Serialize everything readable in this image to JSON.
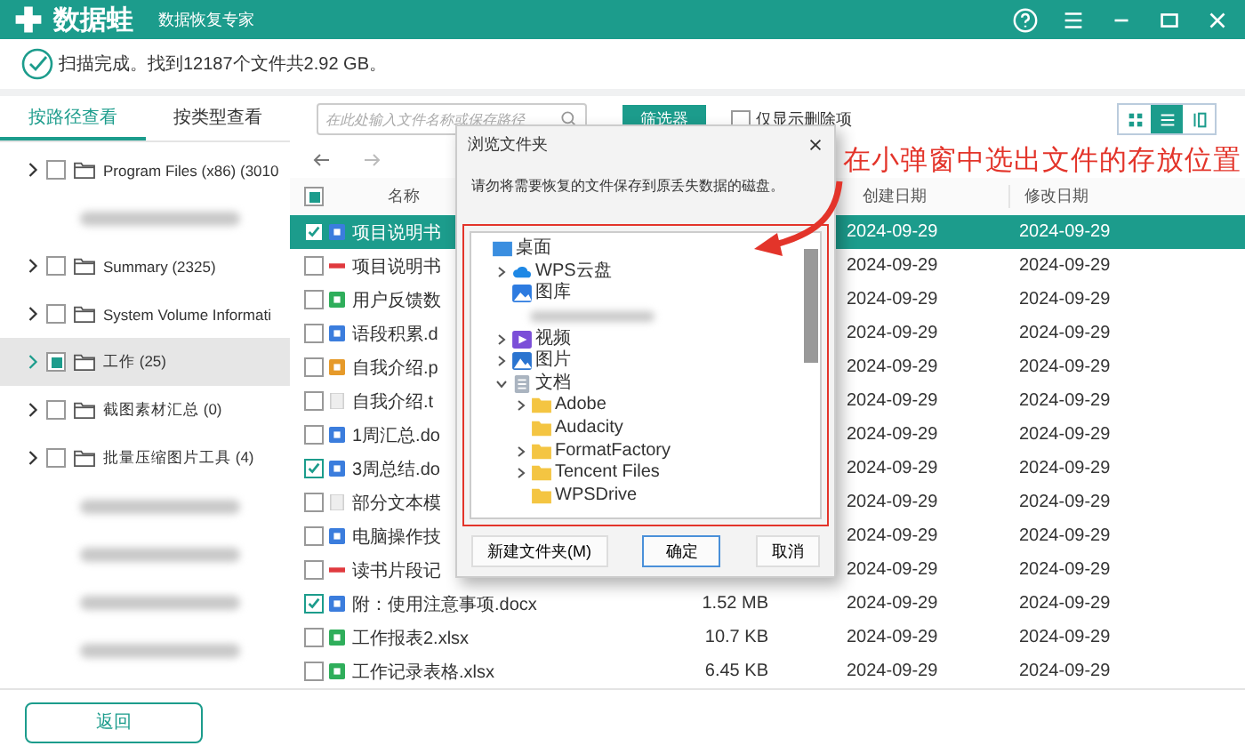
{
  "app": {
    "name": "数据蛙",
    "subtitle": "数据恢复专家"
  },
  "scan_status": "扫描完成。找到12187个文件共2.92 GB。",
  "view_tabs": [
    {
      "label": "按路径查看",
      "selected": true
    },
    {
      "label": "按类型查看",
      "selected": false
    }
  ],
  "search": {
    "placeholder": "在此处输入文件名称或保存路径"
  },
  "filter_button": "筛选器",
  "deleted_only": {
    "label": "仅显示删除项",
    "checked": false
  },
  "view_modes": [
    {
      "kind": "grid",
      "selected": false
    },
    {
      "kind": "list",
      "selected": true
    },
    {
      "kind": "columns",
      "selected": false
    }
  ],
  "folder_tree": [
    {
      "kind": "folder",
      "label": "Program Files (x86) (3010",
      "partial": false,
      "selected": false
    },
    {
      "kind": "blurred"
    },
    {
      "kind": "folder",
      "label": "Summary (2325)",
      "partial": false,
      "selected": false
    },
    {
      "kind": "folder",
      "label": "System Volume Informati",
      "partial": false,
      "selected": false
    },
    {
      "kind": "folder",
      "label": "工作 (25)",
      "partial": true,
      "selected": true
    },
    {
      "kind": "folder",
      "label": "截图素材汇总 (0)",
      "partial": false,
      "selected": false
    },
    {
      "kind": "folder",
      "label": "批量压缩图片工具 (4)",
      "partial": false,
      "selected": false
    },
    {
      "kind": "blurred"
    },
    {
      "kind": "blurred"
    },
    {
      "kind": "blurred"
    },
    {
      "kind": "blurred"
    }
  ],
  "table": {
    "all_partial": true,
    "columns": [
      "名称",
      "创建日期",
      "修改日期"
    ],
    "rows": [
      {
        "kind": "doc",
        "name": "项目说明书",
        "created": "2024-09-29",
        "modified": "2024-09-29",
        "checked": true,
        "selected": true
      },
      {
        "kind": "pdf",
        "name": "项目说明书",
        "created": "2024-09-29",
        "modified": "2024-09-29",
        "checked": false,
        "selected": false
      },
      {
        "kind": "xls",
        "name": "用户反馈数",
        "created": "2024-09-29",
        "modified": "2024-09-29",
        "checked": false,
        "selected": false
      },
      {
        "kind": "doc",
        "name": "语段积累.d",
        "created": "2024-09-29",
        "modified": "2024-09-29",
        "checked": false,
        "selected": false
      },
      {
        "kind": "ppt",
        "name": "自我介绍.p",
        "created": "2024-09-29",
        "modified": "2024-09-29",
        "checked": false,
        "selected": false
      },
      {
        "kind": "txt",
        "name": "自我介绍.t",
        "created": "2024-09-29",
        "modified": "2024-09-29",
        "checked": false,
        "selected": false
      },
      {
        "kind": "doc",
        "name": "1周汇总.do",
        "created": "2024-09-29",
        "modified": "2024-09-29",
        "checked": false,
        "selected": false
      },
      {
        "kind": "doc",
        "name": "3周总结.do",
        "created": "2024-09-29",
        "modified": "2024-09-29",
        "checked": true,
        "selected": false
      },
      {
        "kind": "txt",
        "name": "部分文本模",
        "created": "2024-09-29",
        "modified": "2024-09-29",
        "checked": false,
        "selected": false
      },
      {
        "kind": "doc",
        "name": "电脑操作技",
        "created": "2024-09-29",
        "modified": "2024-09-29",
        "checked": false,
        "selected": false
      },
      {
        "kind": "pdf",
        "name": "读书片段记",
        "created": "2024-09-29",
        "modified": "2024-09-29",
        "checked": false,
        "selected": false
      },
      {
        "kind": "doc",
        "name": "附：使用注意事项.docx",
        "size": "1.52 MB",
        "created": "2024-09-29",
        "modified": "2024-09-29",
        "checked": true,
        "selected": false
      },
      {
        "kind": "xls",
        "name": "工作报表2.xlsx",
        "size": "10.7 KB",
        "created": "2024-09-29",
        "modified": "2024-09-29",
        "checked": false,
        "selected": false
      },
      {
        "kind": "xls",
        "name": "工作记录表格.xlsx",
        "size": "6.45 KB",
        "created": "2024-09-29",
        "modified": "2024-09-29",
        "checked": false,
        "selected": false
      }
    ]
  },
  "back_button": "返回",
  "dialog": {
    "title": "浏览文件夹",
    "message": "请勿将需要恢复的文件保存到原丢失数据的磁盘。",
    "tree": [
      {
        "kind": "desktop",
        "label": "桌面",
        "children": [
          {
            "kind": "cloud",
            "label": "WPS云盘",
            "expanded": false
          },
          {
            "kind": "gallery",
            "label": "图库"
          },
          {
            "kind": "blurred"
          },
          {
            "kind": "video",
            "label": "视频",
            "expanded": false
          },
          {
            "kind": "pictures",
            "label": "图片",
            "expanded": false
          },
          {
            "kind": "documents",
            "label": "文档",
            "expanded": true,
            "children": [
              {
                "kind": "folder",
                "label": "Adobe",
                "expanded": false
              },
              {
                "kind": "folder",
                "label": "Audacity"
              },
              {
                "kind": "folder",
                "label": "FormatFactory",
                "expanded": false
              },
              {
                "kind": "folder",
                "label": "Tencent Files",
                "expanded": false
              },
              {
                "kind": "folder",
                "label": "WPSDrive"
              }
            ]
          }
        ]
      }
    ],
    "buttons": [
      {
        "label": "新建文件夹(M)",
        "default": false
      },
      {
        "label": "确定",
        "default": true
      },
      {
        "label": "取消",
        "default": false
      }
    ]
  },
  "annotation": {
    "text": "在小弹窗中选出文件的存放位置"
  }
}
